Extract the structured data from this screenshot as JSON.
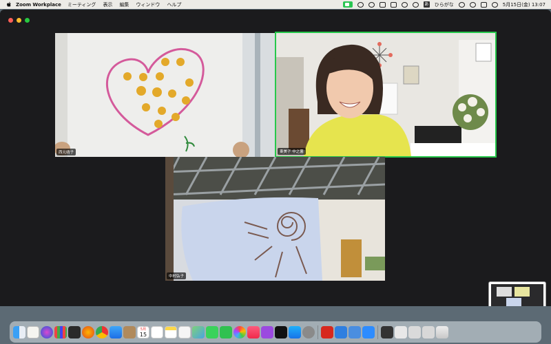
{
  "menubar": {
    "app_name": "Zoom Workplace",
    "menus": [
      "ミーティング",
      "表示",
      "編集",
      "ウィンドウ",
      "ヘルプ"
    ],
    "ime": "ひらがな",
    "ime_badge": "あ",
    "datetime": "5月15日(金) 13:07"
  },
  "participants": [
    {
      "name": "西元靖子",
      "tile": "heart-drawing"
    },
    {
      "name": "東美子 中之薗",
      "tile": "smiling-woman"
    },
    {
      "name": "中村弘子",
      "tile": "sun-drawing"
    }
  ],
  "dock": {
    "icons": [
      "finder-icon",
      "notes-icon",
      "siri-icon",
      "launchpad-icon",
      "mission-control-icon",
      "firefox-icon",
      "chrome-icon",
      "mail-icon",
      "contacts-icon",
      "calendar-icon",
      "reminders-icon",
      "notes-app-icon",
      "freeform-icon",
      "maps-icon",
      "messages-icon",
      "facetime-icon",
      "photos-icon",
      "music-icon",
      "podcasts-icon",
      "tv-icon",
      "app-store-icon",
      "system-settings-icon",
      "acrobat-icon",
      "keynote-icon",
      "preview-icon",
      "zoom-icon",
      "terminal-icon",
      "downloads-icon",
      "trash-icon"
    ],
    "calendar_day": "15",
    "calendar_month": "5月"
  },
  "colors": {
    "active_speaker": "#26c84b",
    "zoom_green": "#29c552"
  }
}
